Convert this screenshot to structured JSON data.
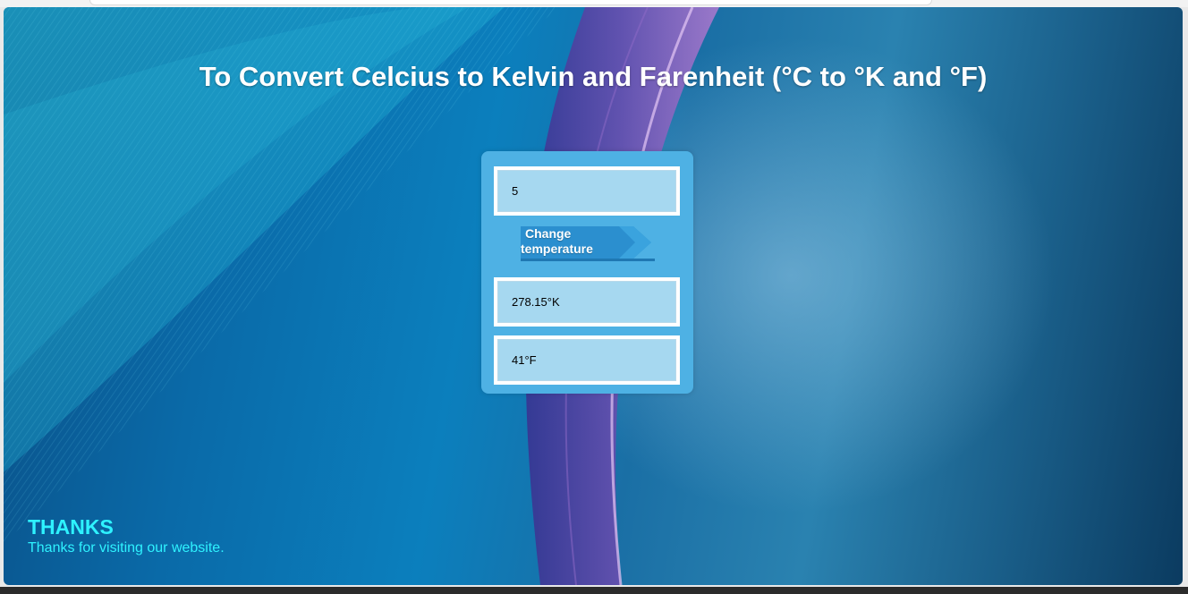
{
  "page": {
    "title": "To Convert Celcius to Kelvin and Farenheit (°C to °K and °F)"
  },
  "converter": {
    "celsius_value": "5",
    "button_label_line1": "Change",
    "button_label_line2": "temperature",
    "kelvin_output": "278.15°K",
    "fahrenheit_output": "41°F"
  },
  "footer": {
    "heading": "THANKS",
    "message": "Thanks for visiting our website."
  },
  "colors": {
    "card_background": "#4eb1e4",
    "field_background": "#a6d8f0",
    "button_background": "#2b8fcf",
    "footer_text": "#2ef2ff"
  }
}
